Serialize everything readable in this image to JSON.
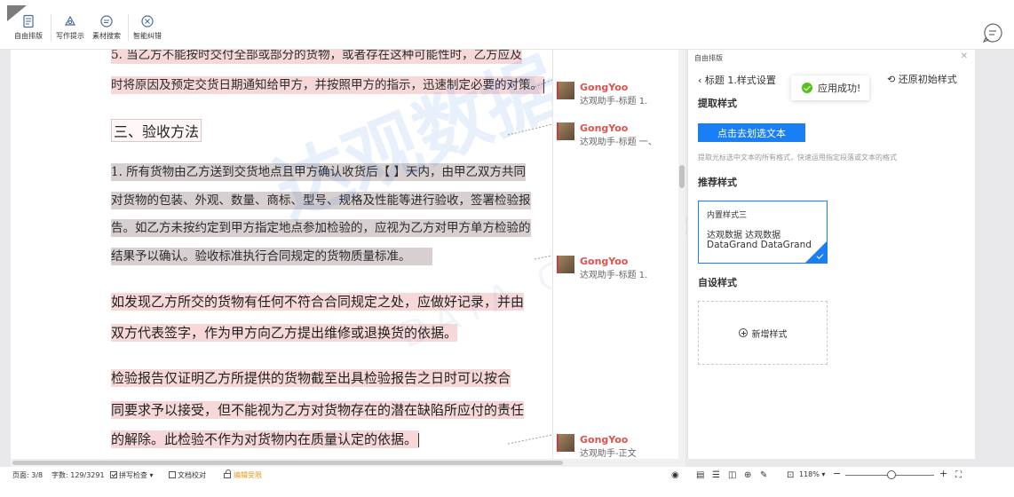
{
  "toolbar": {
    "items": [
      {
        "label": "自由排版",
        "icon": "doc-layout-icon"
      },
      {
        "label": "写作提示",
        "icon": "writing-hint-icon"
      },
      {
        "label": "素材搜索",
        "icon": "material-search-icon"
      },
      {
        "label": "智能纠错",
        "icon": "smart-correct-icon"
      }
    ]
  },
  "document": {
    "lines": [
      "5. 当乙方不能按时交付全部或部分的货物，或者存在这种可能性时，乙方应及",
      "时将原因及预定交货日期通知给甲方，并按照甲方的指示，迅速制定必要的对策。",
      "1. 所有货物由乙方送到交货地点且甲方确认收货后【 】天内，由甲乙双方共同",
      "对货物的包装、外观、数量、商标、型号、规格及性能等进行验收，签署检验报",
      "告。如乙方未按约定到甲方指定地点参加检验的，应视为乙方对甲方单方检验的",
      "结果予以确认。验收标准执行合同规定的货物质量标准。",
      "如发现乙方所交的货物有任何不符合合同规定之处，应做好记录，并由",
      "双方代表签字，作为甲方向乙方提出维修或退换货的依据。",
      "检验报告仅证明乙方所提供的货物截至出具检验报告之日时可以按合",
      "同要求予以接受，但不能视为乙方对货物存在的潜在缺陷所应付的责任",
      "的解除。此检验不作为对货物内在质量认定的依据。"
    ],
    "heading": "三、验收方法"
  },
  "comments": [
    {
      "author": "GongYoo",
      "text": "达观助手-标题 1."
    },
    {
      "author": "GongYoo",
      "text": "达观助手-标题 一、"
    },
    {
      "author": "GongYoo",
      "text": "达观助手-标题 1."
    },
    {
      "author": "GongYoo",
      "text": "达观助手-正文"
    }
  ],
  "panel": {
    "title": "自由排版",
    "back_label": "标题 1.样式设置",
    "restore_label": "还原初始样式",
    "toast": "应用成功!",
    "extract_title": "提取样式",
    "pick_button": "点击去划选文本",
    "hint": "提取光标选中文本的所有格式，快速运用指定段落或文本的格式",
    "recommend_title": "推荐样式",
    "card": {
      "name": "内置样式三",
      "line1": "达观数据 达观数据",
      "line2": "DataGrand DataGrand"
    },
    "custom_title": "自设样式",
    "add_label": "新增样式"
  },
  "status": {
    "page": "页面: 3/8",
    "words": "字数: 129/3291",
    "spell": "拼写检查",
    "proof": "文档校对",
    "edit_limit": "编辑受限",
    "zoom": "118%"
  },
  "watermark": {
    "text": "达观数据",
    "sub": "DATA GRAND"
  },
  "colors": {
    "accent": "#1a7ef5",
    "highlight": "#f6d8d8",
    "comment_author": "#d9534f",
    "success": "#52c41a"
  }
}
